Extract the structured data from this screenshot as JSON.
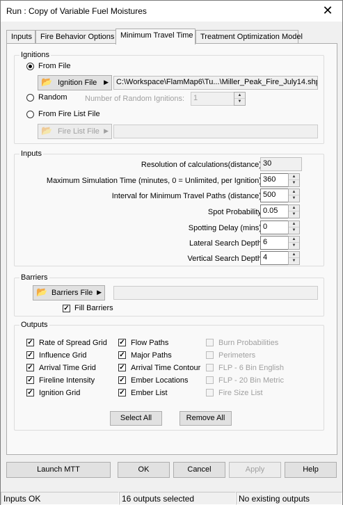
{
  "window": {
    "title": "Run : Copy of Variable Fuel Moistures",
    "close_glyph": "✕"
  },
  "tabs": [
    {
      "label": "Inputs"
    },
    {
      "label": "Fire Behavior Options"
    },
    {
      "label": "Minimum Travel Time"
    },
    {
      "label": "Treatment Optimization Model"
    }
  ],
  "ignitions": {
    "title": "Ignitions",
    "from_file_label": "From File",
    "ignition_file_button": "Ignition File",
    "ignition_file_path": "C:\\Workspace\\FlamMap6\\Tu...\\Miller_Peak_Fire_July14.shp",
    "random_label": "Random",
    "num_random_label": "Number of Random Ignitions:",
    "num_random_value": "1",
    "fire_list_label": "From Fire List File",
    "fire_list_button": "Fire List File",
    "fire_list_path": ""
  },
  "inputs": {
    "title": "Inputs",
    "fields": [
      {
        "label": "Resolution of calculations(distance):",
        "value": "30"
      },
      {
        "label": "Maximum Simulation Time (minutes, 0 = Unlimited, per Ignition):",
        "value": "360"
      },
      {
        "label": "Interval for Minimum Travel Paths (distance):",
        "value": "500"
      },
      {
        "label": "Spot Probability:",
        "value": "0.05"
      },
      {
        "label": "Spotting Delay (mins):",
        "value": "0"
      },
      {
        "label": "Lateral Search Depth:",
        "value": "6"
      },
      {
        "label": "Vertical Search Depth:",
        "value": "4"
      }
    ]
  },
  "barriers": {
    "title": "Barriers",
    "button": "Barriers File",
    "path": "",
    "fill_label": "Fill Barriers"
  },
  "outputs": {
    "title": "Outputs",
    "col1": [
      "Rate of Spread Grid",
      "Influence Grid",
      "Arrival Time Grid",
      "Fireline Intensity",
      "Ignition Grid"
    ],
    "col2": [
      "Flow Paths",
      "Major Paths",
      "Arrival Time Contour",
      "Ember Locations",
      "Ember List"
    ],
    "col3": [
      "Burn Probabilities",
      "Perimeters",
      "FLP - 6 Bin English",
      "FLP - 20 Bin Metric",
      "Fire Size List"
    ],
    "check_glyph": "✓",
    "select_all": "Select All",
    "remove_all": "Remove All"
  },
  "buttons": {
    "launch": "Launch MTT",
    "ok": "OK",
    "cancel": "Cancel",
    "apply": "Apply",
    "help": "Help"
  },
  "status": {
    "left": "Inputs OK",
    "middle": "16 outputs selected",
    "right": "No existing outputs"
  },
  "icons": {
    "folder": "📂",
    "arrow": "▶",
    "up": "▲",
    "down": "▼"
  }
}
